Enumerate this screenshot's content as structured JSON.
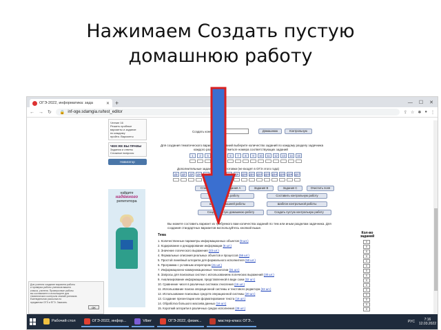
{
  "slide": {
    "title_line1": "Нажимаем Создать пустую",
    "title_line2": "домашнюю работу"
  },
  "browser": {
    "tab_title": "ОГЭ-2022, информатика: зада",
    "url": "inf-oge.sdamgia.ru/test_editor",
    "colors": {
      "tabbar": "#dee1e6",
      "taskbar": "#1f2b3c",
      "arrow_fill": "#3a6fd0",
      "arrow_stroke": "#d92020"
    }
  },
  "sidebar": {
    "box1": [
      "Чтение 16",
      "Решить пробные",
      "варианты и задание",
      "по каждому",
      "пройти. Варианты"
    ],
    "box2_head": "ЧЕМ ЖЕ ВЫ ПРАВЫ",
    "box2": [
      "Задания и ответы",
      "Сложные вопросы"
    ],
    "button": "Навигатор"
  },
  "ad": {
    "line1": "найдите",
    "line2": "надёжного",
    "line3": "репетитора"
  },
  "left_note": {
    "text": [
      "Для учителя создание варианта работы",
      "и проверка работы учеников вашего",
      "класса, учителя. Проверочные работы",
      "вы составляете и используете для",
      "тематического контроля знаний учеников.",
      "",
      "Еженедельная рассылка по",
      "предметам ОГЭ и ЕГЭ. Заказать."
    ],
    "ok": "OK"
  },
  "content": {
    "create_label": "Создать конкретный",
    "btn_home": "Домашнюю",
    "btn_control": "Контрольную",
    "instr1": "Для создания тематического варианта из заданий выберите количество заданий по каждому разделу задачника",
    "instr2": "каждого раздела или отметьте номера соответствующих заданий",
    "instr3": "Дополнительные задания для подготовки (не входят в ОГЭ этого года)",
    "nums1": [
      "1",
      "2",
      "3",
      "4",
      "5",
      "6",
      "7",
      "8",
      "9",
      "10",
      "11",
      "12",
      "13",
      "14",
      "15"
    ],
    "nums2": [
      "Д1",
      "Д2",
      "Д3",
      "Д4",
      "Д5",
      "Д6",
      "Д7",
      "Д8",
      "Д9",
      "Д10",
      "Д11",
      "Д12",
      "Д13",
      "Д14",
      "Д15",
      "Д16",
      "Д17"
    ],
    "btns_row1": [
      "Стандарт",
      "Задания А",
      "Задания В",
      "Задания С",
      "Очистить поля"
    ],
    "btn_create_work": "Составить работу",
    "btn_create_control": "Составить контрольную работу",
    "btn_template": "Шаблон домашней работы",
    "btn_template_control": "Шаблон контрольной работы",
    "btn_empty_home": "Создать пустую домашнюю работу",
    "btn_empty_control": "Создать пустую контрольную работу",
    "note1": "Вы можете составить вариант из требуемого вам количества заданий по тем или иным разделам задачника. Для",
    "note2": "создания стандартных вариантов воспользуйтесь кнопкой выше."
  },
  "table": {
    "head": "Тема",
    "col_head": "Кол-во заданий",
    "rows": [
      {
        "n": "1.",
        "text": "Количественные параметры информационных объектов",
        "link": "(9 шт.)"
      },
      {
        "n": "2.",
        "text": "Кодирование и декодирование информации",
        "link": "(6 шт.)"
      },
      {
        "n": "3.",
        "text": "Значение логического выражения",
        "link": "(23 шт.)"
      },
      {
        "n": "4.",
        "text": "Формальные описания реальных объектов и процессов",
        "link": "(56 шт.)"
      },
      {
        "n": "5.",
        "text": "Простой линейный алгоритм для формального исполнителя",
        "link": "(50 шт.)"
      },
      {
        "n": "6.",
        "text": "Программа с условным оператором",
        "link": "(41 шт.)"
      },
      {
        "n": "7.",
        "text": "Информационно-коммуникационные технологии",
        "link": "(31 шт.)"
      },
      {
        "n": "8.",
        "text": "Запросы для поисковых систем с использованием логических выражений",
        "link": "(30 шт.)"
      },
      {
        "n": "9.",
        "text": "Анализирование информации, представленной в виде схем",
        "link": "(32 шт.)"
      },
      {
        "n": "10.",
        "text": "Сравнение чисел в различных системах счисления",
        "link": "(16 шт.)"
      },
      {
        "n": "11.",
        "text": "Использование поиска операционной системы и текстового редактора",
        "link": "(22 шт.)"
      },
      {
        "n": "12.",
        "text": "Использование поисковых средств операционной системы",
        "link": "(20 шт.)"
      },
      {
        "n": "13.",
        "text": "Создание презентации или форматирование текста",
        "link": "(16 шт.)"
      },
      {
        "n": "14.",
        "text": "Обработка большого массива данных",
        "link": "(16 шт.)"
      },
      {
        "n": "15.",
        "text": "Короткий алгоритм в различных средах исполнения",
        "link": "(28 шт.)"
      }
    ],
    "cells": [
      "0",
      "0",
      "0",
      "0",
      "0",
      "0",
      "0",
      "0",
      "0",
      "0",
      "0",
      "0",
      "0",
      "0",
      "0"
    ]
  },
  "taskbar": {
    "items": [
      {
        "label": "Рабочий стол",
        "color": "#f0c040"
      },
      {
        "label": "ОГЭ-2022, инфор...",
        "color": "#e04030"
      },
      {
        "label": "Viber",
        "color": "#7b5dd6"
      },
      {
        "label": "ОГЭ-2022, физик...",
        "color": "#e04030"
      },
      {
        "label": "мастер-класс ОГЭ...",
        "color": "#c0392b"
      }
    ],
    "lang": "РУС",
    "time": "7:16",
    "date": "12.03.2022"
  }
}
